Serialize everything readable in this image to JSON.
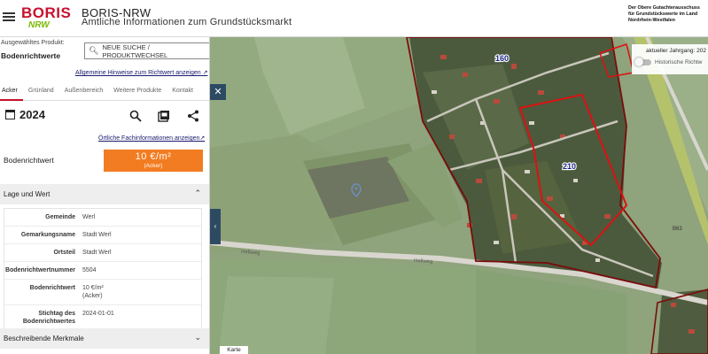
{
  "header": {
    "logo_main": "BORIS",
    "logo_sub": "NRW",
    "title": "BORIS-NRW",
    "subtitle": "Amtliche Informationen zum Grundstücksmarkt",
    "org_lines": [
      "Der Obere Gutachterausschuss",
      "für Grundstückswerte im Land",
      "Nordrhein-Westfalen"
    ]
  },
  "panel": {
    "product_label": "Ausgewähltes Produkt:",
    "product_value": "Bodenrichtwerte",
    "search_button": "NEUE SUCHE / PRODUKTWECHSEL",
    "hints_link": "Allgemeine Hinweise zum Richtwert anzeigen ↗",
    "tabs": [
      "Acker",
      "Grünland",
      "Außenbereich",
      "Weitere Produkte",
      "Kontakt"
    ],
    "active_tab": "Acker",
    "year": "2024",
    "fach_link": "Örtliche Fachinformationen anzeigen↗",
    "brw_label": "Bodenrichtwert",
    "brw_value": "10 €/m²",
    "brw_unit": "(Acker)",
    "section_lage": "Lage und Wert",
    "section_merkmale": "Beschreibende Merkmale",
    "details": [
      {
        "key": "Gemeinde",
        "value": "Werl",
        "extra": ""
      },
      {
        "key": "Gemarkungsname",
        "value": "Stadt Werl",
        "extra": ""
      },
      {
        "key": "Ortsteil",
        "value": "Stadt Werl",
        "extra": ""
      },
      {
        "key": "Bodenrichtwertnummer",
        "value": "5504",
        "extra": ""
      },
      {
        "key": "Bodenrichtwert",
        "value": "10 €/m²",
        "extra": "(Acker)"
      },
      {
        "key": "Stichtag des Bodenrichtwertes",
        "value": "2024-01-01",
        "extra": ""
      }
    ]
  },
  "map": {
    "zone_labels": [
      "160",
      "210"
    ],
    "year_label": "aktueller Jahrgang: 202",
    "hist_label": "Historische Richtw",
    "map_tab": "Karte",
    "street_labels": [
      "Hellweg",
      "Hellweg"
    ],
    "road_sign": "B63"
  },
  "colors": {
    "brand_red": "#c8102e",
    "value_orange": "#f27c21",
    "boundary": "#8b0000"
  }
}
